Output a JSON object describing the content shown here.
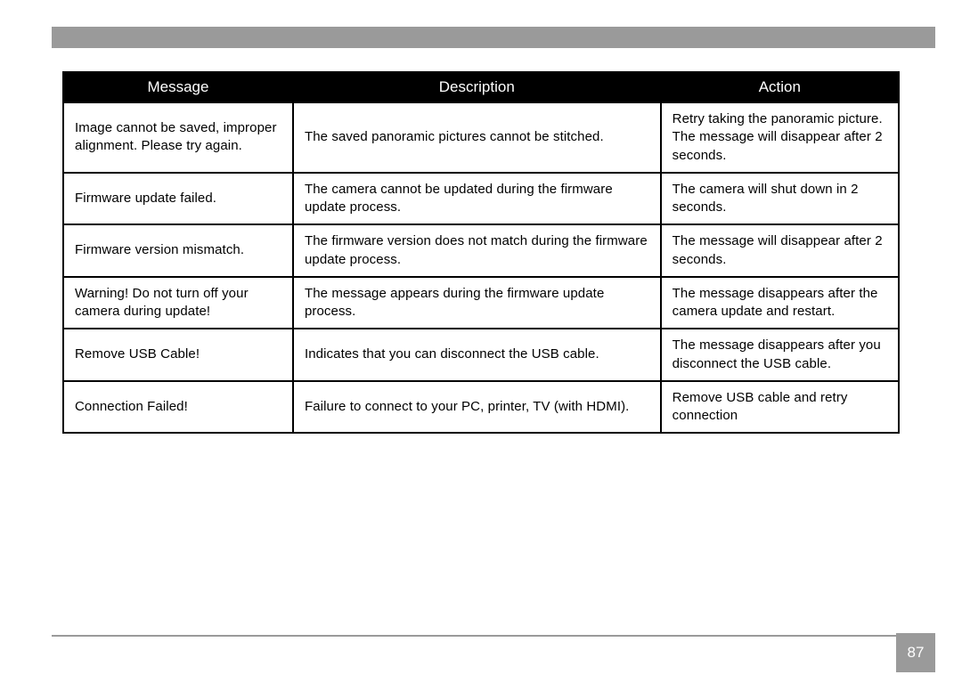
{
  "table": {
    "headers": {
      "message": "Message",
      "description": "Description",
      "action": "Action"
    },
    "rows": [
      {
        "message": "Image cannot be saved, improper alignment. Please try again.",
        "description": "The saved panoramic pictures cannot be stitched.",
        "action": "Retry taking the panoramic picture. The message will disappear after 2 seconds."
      },
      {
        "message": "Firmware update failed.",
        "description": "The camera cannot be updated during the firmware update process.",
        "action": "The camera will shut down in 2 seconds."
      },
      {
        "message": "Firmware version mismatch.",
        "description": "The firmware version does not match during the firmware update process.",
        "action": "The message will disappear after 2 seconds."
      },
      {
        "message": "Warning! Do not turn off your camera during update!",
        "description": "The message appears during the firmware update process.",
        "action": "The message disappears after the camera update and restart."
      },
      {
        "message": "Remove USB Cable!",
        "description": "Indicates that you can disconnect the USB cable.",
        "action": "The message disappears after you disconnect the USB cable."
      },
      {
        "message": "Connection Failed!",
        "description": "Failure to connect to your PC, printer, TV (with HDMI).",
        "action": "Remove USB cable and retry connection"
      }
    ]
  },
  "page_number": "87"
}
